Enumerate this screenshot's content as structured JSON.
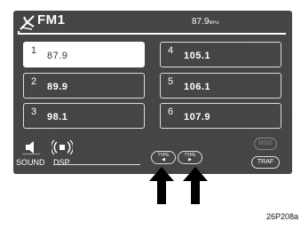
{
  "header": {
    "band": "FM1",
    "frequency": "87.9",
    "frequency_unit": "MHz",
    "band_icon": "antenna-icon"
  },
  "presets": [
    {
      "number": "1",
      "frequency": "87.9",
      "selected": true
    },
    {
      "number": "2",
      "frequency": "89.9"
    },
    {
      "number": "3",
      "frequency": "98.1"
    },
    {
      "number": "4",
      "frequency": "105.1"
    },
    {
      "number": "5",
      "frequency": "106.1"
    },
    {
      "number": "6",
      "frequency": "107.9"
    }
  ],
  "controls": {
    "sound_label": "SOUND",
    "dsp_label": "DSP",
    "type_left_label": "TYPE",
    "type_right_label": "TYPE",
    "type_left_arrow": "◀",
    "type_right_arrow": "▶",
    "msg_label": "MSG",
    "traf_label": "TRAF"
  },
  "figure_code": "26P208a"
}
